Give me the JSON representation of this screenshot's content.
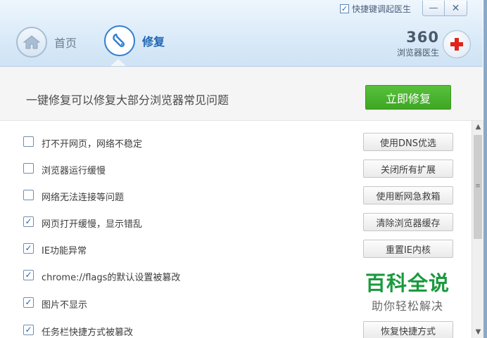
{
  "window": {
    "shortcut_checkbox_checked": true,
    "shortcut_label": "快捷键调起医生",
    "minimize_symbol": "—",
    "close_symbol": "✕"
  },
  "nav": {
    "home_label": "首页",
    "repair_label": "修复",
    "home_icon": "house-icon",
    "repair_icon": "wrench-icon"
  },
  "brand": {
    "number": "360",
    "subtitle": "浏览器医生"
  },
  "banner": {
    "text": "一键修复可以修复大部分浏览器常见问题",
    "fix_button": "立即修复"
  },
  "items": [
    {
      "label": "打不开网页，网络不稳定",
      "checked": false,
      "button": "使用DNS优选"
    },
    {
      "label": "浏览器运行缓慢",
      "checked": false,
      "button": "关闭所有扩展"
    },
    {
      "label": "网络无法连接等问题",
      "checked": false,
      "button": "使用断网急救箱"
    },
    {
      "label": "网页打开缓慢，显示错乱",
      "checked": true,
      "button": "清除浏览器缓存"
    },
    {
      "label": "IE功能异常",
      "checked": true,
      "button": "重置IE内核"
    },
    {
      "label": "chrome://flags的默认设置被篡改",
      "checked": true,
      "button": ""
    },
    {
      "label": "图片不显示",
      "checked": true,
      "button": ""
    },
    {
      "label": "任务栏快捷方式被篡改",
      "checked": true,
      "button": "恢复快捷方式"
    }
  ],
  "watermark": {
    "title": "百科全说",
    "subtitle": "助你轻松解决"
  },
  "colors": {
    "accent_blue": "#2166b4",
    "fix_green": "#3ea623",
    "watermark_green": "#1a9a3e"
  }
}
